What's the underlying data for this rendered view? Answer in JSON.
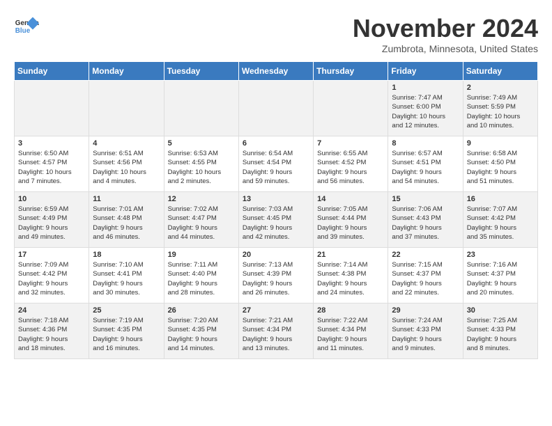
{
  "header": {
    "logo_general": "General",
    "logo_blue": "Blue",
    "month_title": "November 2024",
    "location": "Zumbrota, Minnesota, United States"
  },
  "days_of_week": [
    "Sunday",
    "Monday",
    "Tuesday",
    "Wednesday",
    "Thursday",
    "Friday",
    "Saturday"
  ],
  "weeks": [
    [
      {
        "day": "",
        "info": ""
      },
      {
        "day": "",
        "info": ""
      },
      {
        "day": "",
        "info": ""
      },
      {
        "day": "",
        "info": ""
      },
      {
        "day": "",
        "info": ""
      },
      {
        "day": "1",
        "info": "Sunrise: 7:47 AM\nSunset: 6:00 PM\nDaylight: 10 hours\nand 12 minutes."
      },
      {
        "day": "2",
        "info": "Sunrise: 7:49 AM\nSunset: 5:59 PM\nDaylight: 10 hours\nand 10 minutes."
      }
    ],
    [
      {
        "day": "3",
        "info": "Sunrise: 6:50 AM\nSunset: 4:57 PM\nDaylight: 10 hours\nand 7 minutes."
      },
      {
        "day": "4",
        "info": "Sunrise: 6:51 AM\nSunset: 4:56 PM\nDaylight: 10 hours\nand 4 minutes."
      },
      {
        "day": "5",
        "info": "Sunrise: 6:53 AM\nSunset: 4:55 PM\nDaylight: 10 hours\nand 2 minutes."
      },
      {
        "day": "6",
        "info": "Sunrise: 6:54 AM\nSunset: 4:54 PM\nDaylight: 9 hours\nand 59 minutes."
      },
      {
        "day": "7",
        "info": "Sunrise: 6:55 AM\nSunset: 4:52 PM\nDaylight: 9 hours\nand 56 minutes."
      },
      {
        "day": "8",
        "info": "Sunrise: 6:57 AM\nSunset: 4:51 PM\nDaylight: 9 hours\nand 54 minutes."
      },
      {
        "day": "9",
        "info": "Sunrise: 6:58 AM\nSunset: 4:50 PM\nDaylight: 9 hours\nand 51 minutes."
      }
    ],
    [
      {
        "day": "10",
        "info": "Sunrise: 6:59 AM\nSunset: 4:49 PM\nDaylight: 9 hours\nand 49 minutes."
      },
      {
        "day": "11",
        "info": "Sunrise: 7:01 AM\nSunset: 4:48 PM\nDaylight: 9 hours\nand 46 minutes."
      },
      {
        "day": "12",
        "info": "Sunrise: 7:02 AM\nSunset: 4:47 PM\nDaylight: 9 hours\nand 44 minutes."
      },
      {
        "day": "13",
        "info": "Sunrise: 7:03 AM\nSunset: 4:45 PM\nDaylight: 9 hours\nand 42 minutes."
      },
      {
        "day": "14",
        "info": "Sunrise: 7:05 AM\nSunset: 4:44 PM\nDaylight: 9 hours\nand 39 minutes."
      },
      {
        "day": "15",
        "info": "Sunrise: 7:06 AM\nSunset: 4:43 PM\nDaylight: 9 hours\nand 37 minutes."
      },
      {
        "day": "16",
        "info": "Sunrise: 7:07 AM\nSunset: 4:42 PM\nDaylight: 9 hours\nand 35 minutes."
      }
    ],
    [
      {
        "day": "17",
        "info": "Sunrise: 7:09 AM\nSunset: 4:42 PM\nDaylight: 9 hours\nand 32 minutes."
      },
      {
        "day": "18",
        "info": "Sunrise: 7:10 AM\nSunset: 4:41 PM\nDaylight: 9 hours\nand 30 minutes."
      },
      {
        "day": "19",
        "info": "Sunrise: 7:11 AM\nSunset: 4:40 PM\nDaylight: 9 hours\nand 28 minutes."
      },
      {
        "day": "20",
        "info": "Sunrise: 7:13 AM\nSunset: 4:39 PM\nDaylight: 9 hours\nand 26 minutes."
      },
      {
        "day": "21",
        "info": "Sunrise: 7:14 AM\nSunset: 4:38 PM\nDaylight: 9 hours\nand 24 minutes."
      },
      {
        "day": "22",
        "info": "Sunrise: 7:15 AM\nSunset: 4:37 PM\nDaylight: 9 hours\nand 22 minutes."
      },
      {
        "day": "23",
        "info": "Sunrise: 7:16 AM\nSunset: 4:37 PM\nDaylight: 9 hours\nand 20 minutes."
      }
    ],
    [
      {
        "day": "24",
        "info": "Sunrise: 7:18 AM\nSunset: 4:36 PM\nDaylight: 9 hours\nand 18 minutes."
      },
      {
        "day": "25",
        "info": "Sunrise: 7:19 AM\nSunset: 4:35 PM\nDaylight: 9 hours\nand 16 minutes."
      },
      {
        "day": "26",
        "info": "Sunrise: 7:20 AM\nSunset: 4:35 PM\nDaylight: 9 hours\nand 14 minutes."
      },
      {
        "day": "27",
        "info": "Sunrise: 7:21 AM\nSunset: 4:34 PM\nDaylight: 9 hours\nand 13 minutes."
      },
      {
        "day": "28",
        "info": "Sunrise: 7:22 AM\nSunset: 4:34 PM\nDaylight: 9 hours\nand 11 minutes."
      },
      {
        "day": "29",
        "info": "Sunrise: 7:24 AM\nSunset: 4:33 PM\nDaylight: 9 hours\nand 9 minutes."
      },
      {
        "day": "30",
        "info": "Sunrise: 7:25 AM\nSunset: 4:33 PM\nDaylight: 9 hours\nand 8 minutes."
      }
    ]
  ]
}
